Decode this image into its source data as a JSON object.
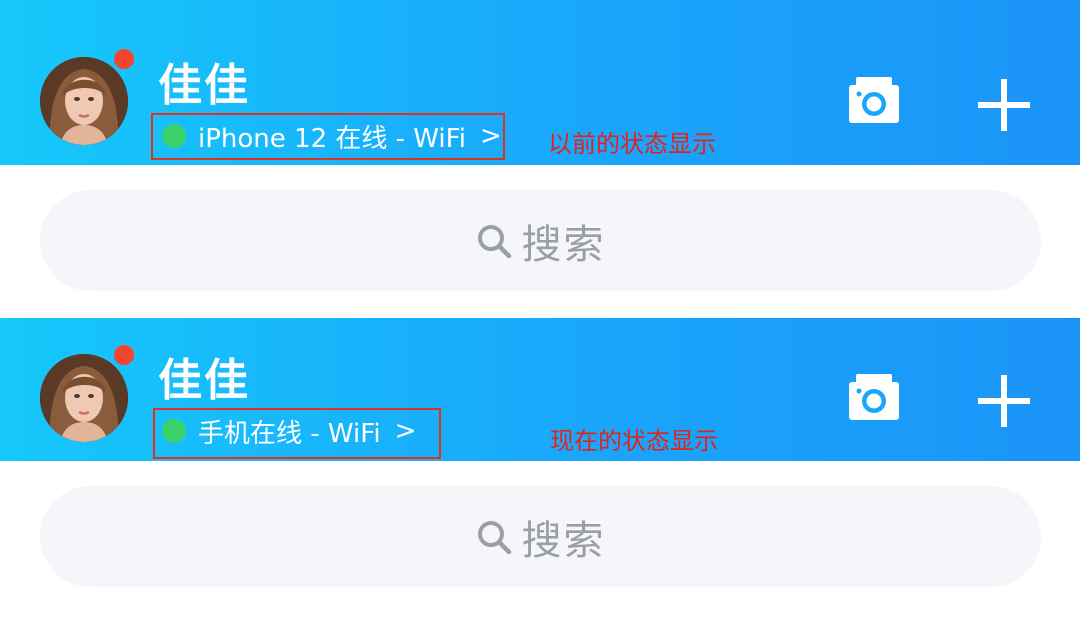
{
  "colors": {
    "header_gradient_start": "#16c8fb",
    "header_gradient_end": "#1b94f8",
    "online": "#3ad36b",
    "badge": "#f2452f",
    "annotation": "#e3231b",
    "search_bg": "#f5f6fa",
    "search_text": "#9b9ea6"
  },
  "previous": {
    "user_name": "佳佳",
    "status_text": "iPhone 12 在线 - WiFi",
    "chevron": ">",
    "annotation": "以前的状态显示",
    "icons": [
      "camera-icon",
      "plus-icon",
      "search-icon"
    ],
    "search_placeholder": "搜索"
  },
  "current": {
    "user_name": "佳佳",
    "status_text": "手机在线 - WiFi",
    "chevron": ">",
    "annotation": "现在的状态显示",
    "icons": [
      "camera-icon",
      "plus-icon",
      "search-icon"
    ],
    "search_placeholder": "搜索"
  }
}
